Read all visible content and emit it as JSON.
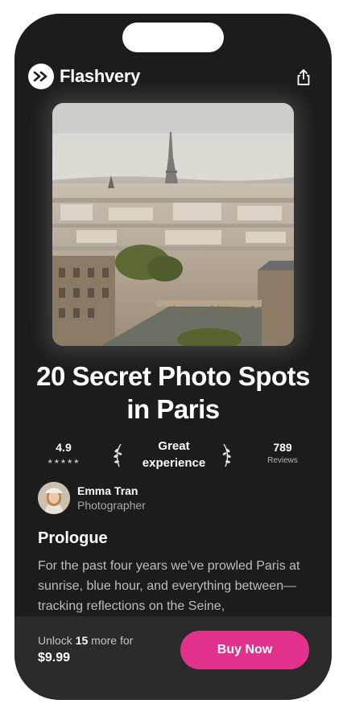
{
  "app": {
    "name": "Flashvery"
  },
  "header": {
    "logo_icon": "fast-forward-icon",
    "share_icon": "share-icon"
  },
  "hero": {
    "alt": "Paris rooftops with the Eiffel Tower"
  },
  "guide": {
    "title": "20 Secret Photo Spots in Paris",
    "rating": "4.9",
    "stars": "★★★★★",
    "badge_line1": "Great",
    "badge_line2": "experience",
    "reviews_count": "789",
    "reviews_label": "Reviews"
  },
  "author": {
    "name": "Emma Tran",
    "role": "Photographer"
  },
  "content": {
    "section_title": "Prologue",
    "body": "For the past four years we’ve prowled Paris at sunrise, blue hour, and everything between—tracking reflections on the Seine,"
  },
  "purchase": {
    "unlock_prefix": "Unlock ",
    "unlock_count": "15",
    "unlock_suffix": " more for",
    "price": "$9.99",
    "buy_label": "Buy Now"
  },
  "colors": {
    "background": "#1c1c1c",
    "bottom_bar": "#2a2a2a",
    "accent": "#e1318a"
  }
}
